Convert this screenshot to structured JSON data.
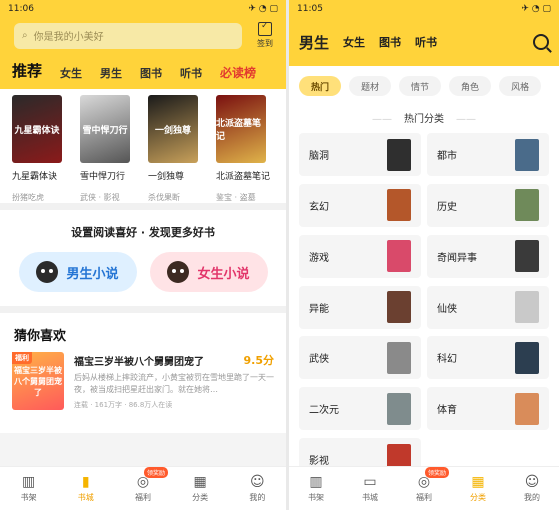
{
  "left": {
    "status": {
      "time": "11:06",
      "icons": "✈ ◔ ▢"
    },
    "search": {
      "placeholder": "你是我的小美好",
      "checkin_label": "签到"
    },
    "tabs": [
      {
        "label": "推荐"
      },
      {
        "label": "女生"
      },
      {
        "label": "男生"
      },
      {
        "label": "图书"
      },
      {
        "label": "听书"
      },
      {
        "label": "必读榜"
      }
    ],
    "books": [
      {
        "title": "九星霸体诀",
        "sub": "扮猪吃虎",
        "cover_text": "九星霸体诀",
        "color1": "#2a2a2a",
        "color2": "#8b1a1a"
      },
      {
        "title": "雪中悍刀行",
        "sub": "武侠 · 影视",
        "cover_text": "雪中悍刀行",
        "color1": "#d9d9d9",
        "color2": "#555555"
      },
      {
        "title": "一剑独尊",
        "sub": "杀伐果断",
        "cover_text": "一剑独尊",
        "color1": "#1a1a1a",
        "color2": "#c9a15a"
      },
      {
        "title": "北派盗墓笔记",
        "sub": "鉴宝 · 盗墓",
        "cover_text": "北派盗墓笔记",
        "color1": "#7a1010",
        "color2": "#e0b44a"
      }
    ],
    "pref": {
      "title": "设置阅读喜好 · 发现更多好书",
      "male": "男生小说",
      "female": "女生小说"
    },
    "guess": {
      "title": "猜你喜欢",
      "book_title": "福宝三岁半被八个舅舅团宠了",
      "score": "9.5分",
      "desc": "后妈从楼梯上摔跤流产，小黄宝被罚在雪地里跪了一天一夜，被当成扫把星赶出家门。就在她将…",
      "meta": "连载 · 161万字 · 86.8万人在读",
      "cover_text": "福宝三岁半被八个舅舅团宠了",
      "tag": "福利"
    },
    "nav": [
      {
        "label": "书架",
        "icon": "bookshelf-icon",
        "glyph": "▥"
      },
      {
        "label": "书城",
        "icon": "bookstore-icon",
        "glyph": "▮"
      },
      {
        "label": "福利",
        "icon": "welfare-icon",
        "glyph": "◎",
        "badge": "领奖励"
      },
      {
        "label": "分类",
        "icon": "category-icon",
        "glyph": "▦"
      },
      {
        "label": "我的",
        "icon": "profile-icon",
        "glyph": "☺"
      }
    ]
  },
  "right": {
    "status": {
      "time": "11:05",
      "icons": "✈ ◔ ▢"
    },
    "tabs": [
      {
        "label": "男生"
      },
      {
        "label": "女生"
      },
      {
        "label": "图书"
      },
      {
        "label": "听书"
      }
    ],
    "chips": [
      {
        "label": "热门"
      },
      {
        "label": "题材"
      },
      {
        "label": "情节"
      },
      {
        "label": "角色"
      },
      {
        "label": "风格"
      }
    ],
    "section_title": "热门分类",
    "categories": [
      {
        "label": "脑洞",
        "color": "#2f2f2f"
      },
      {
        "label": "都市",
        "color": "#4a6b8a"
      },
      {
        "label": "玄幻",
        "color": "#b4572a"
      },
      {
        "label": "历史",
        "color": "#6f8a5a"
      },
      {
        "label": "游戏",
        "color": "#d94a6a"
      },
      {
        "label": "奇闻异事",
        "color": "#3a3a3a"
      },
      {
        "label": "异能",
        "color": "#6b4030"
      },
      {
        "label": "仙侠",
        "color": "#c9c9c9"
      },
      {
        "label": "武侠",
        "color": "#8a8a8a"
      },
      {
        "label": "科幻",
        "color": "#2c3e50"
      },
      {
        "label": "二次元",
        "color": "#7f8c8d"
      },
      {
        "label": "体育",
        "color": "#d98c5a"
      },
      {
        "label": "影视",
        "color": "#c0392b"
      }
    ],
    "nav": [
      {
        "label": "书架",
        "icon": "bookshelf-icon",
        "glyph": "▥"
      },
      {
        "label": "书城",
        "icon": "bookstore-icon",
        "glyph": "▭"
      },
      {
        "label": "福利",
        "icon": "welfare-icon",
        "glyph": "◎",
        "badge": "领奖励"
      },
      {
        "label": "分类",
        "icon": "category-icon",
        "glyph": "▦"
      },
      {
        "label": "我的",
        "icon": "profile-icon",
        "glyph": "☺"
      }
    ]
  }
}
